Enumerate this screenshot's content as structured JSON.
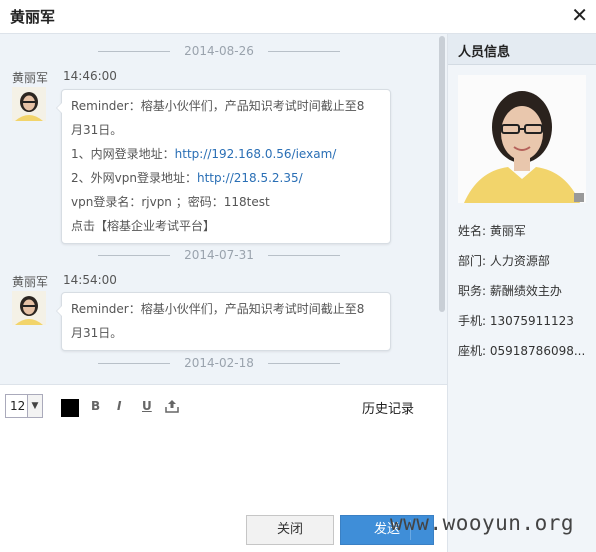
{
  "window": {
    "title": "黄丽军",
    "close_glyph": "✕"
  },
  "messages": [
    {
      "date": "2014-08-26",
      "sender": "黄丽军",
      "time": "14:46:00",
      "lines": [
        {
          "text": "Reminder：榕基小伙伴们，产品知识考试时间截止至8"
        },
        {
          "text": "月31日。"
        },
        {
          "prefix": "1、内网登录地址：",
          "link": "http://192.168.0.56/iexam/"
        },
        {
          "prefix": "2、外网vpn登录地址：",
          "link": "http://218.5.2.35/"
        },
        {
          "text": "vpn登录名：rjvpn ；密码：118test"
        },
        {
          "text": "点击【榕基企业考试平台】"
        }
      ]
    },
    {
      "date": "2014-07-31",
      "sender": "黄丽军",
      "time": "14:54:00",
      "lines": [
        {
          "text": "Reminder：榕基小伙伴们，产品知识考试时间截止至8"
        },
        {
          "text": "月31日。"
        }
      ]
    },
    {
      "date": "2014-02-18"
    }
  ],
  "toolbar": {
    "font_size": "12",
    "dropdown_glyph": "▼",
    "color": "#000000",
    "bold_glyph": "B",
    "italic_glyph": "I",
    "underline_glyph": "U",
    "upload_icon": "upload-icon",
    "history_label": "历史记录"
  },
  "buttons": {
    "close": "关闭",
    "send": "发送"
  },
  "panel": {
    "title": "人员信息",
    "fields": [
      {
        "label": "姓名:",
        "value": "黄丽军"
      },
      {
        "label": "部门:",
        "value": "人力资源部"
      },
      {
        "label": "职务:",
        "value": "薪酬绩效主办"
      },
      {
        "label": "手机:",
        "value": "13075911123"
      },
      {
        "label": "座机:",
        "value": "05918786098..."
      }
    ]
  },
  "watermark": "www.wooyun.org",
  "colors": {
    "accent": "#3f8ed8",
    "link": "#2a6fb5",
    "chat_bg": "#eef3f8"
  }
}
